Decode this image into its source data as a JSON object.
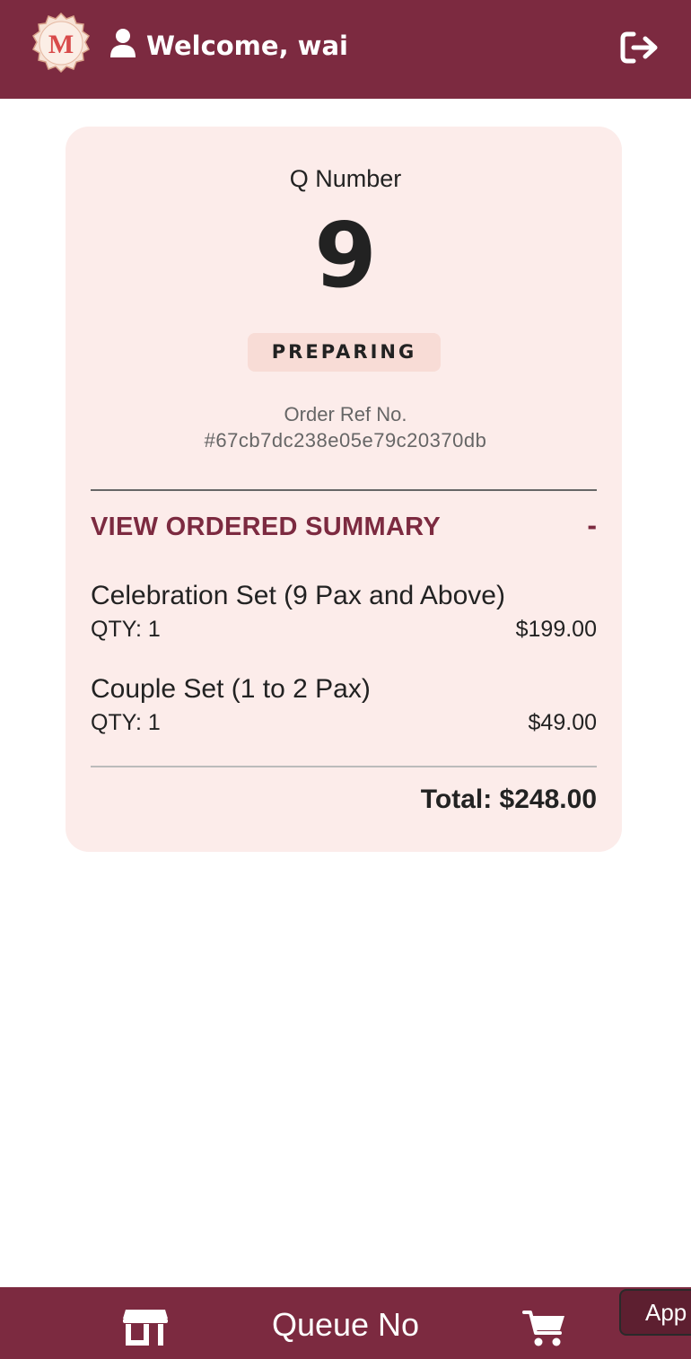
{
  "header": {
    "logo_letter": "M",
    "welcome_text": "Welcome, wai",
    "icons": [
      "logo",
      "user-icon",
      "logout-icon"
    ]
  },
  "order": {
    "q_label": "Q Number",
    "q_number": "9",
    "status": "PREPARING",
    "ref_label": "Order Ref No.",
    "ref_value": "#67cb7dc238e05e79c20370db"
  },
  "summary": {
    "title": "VIEW ORDERED SUMMARY",
    "toggle_symbol": "-",
    "items": [
      {
        "name": "Celebration Set (9 Pax and Above)",
        "qty": "QTY: 1",
        "price": "$199.00"
      },
      {
        "name": "Couple Set (1 to 2 Pax)",
        "qty": "QTY: 1",
        "price": "$49.00"
      }
    ],
    "total": "Total: $248.00"
  },
  "bottom_nav": {
    "queue_label": "Queue No",
    "app_button": "App",
    "icons": [
      "store-icon",
      "cart-icon"
    ]
  },
  "colors": {
    "brand": "#7c2a40",
    "card_bg": "#fcecea",
    "badge_bg": "#f8dcd6"
  }
}
